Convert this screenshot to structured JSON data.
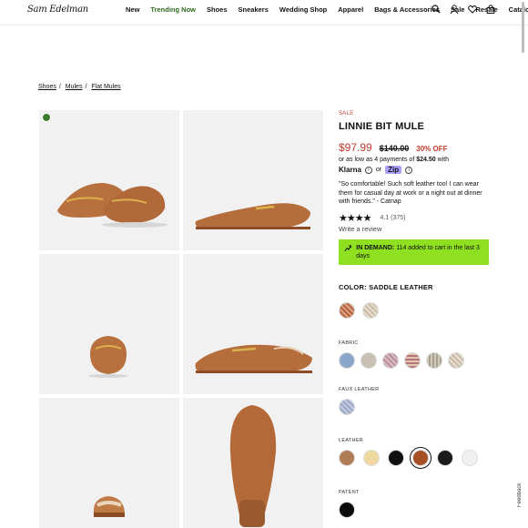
{
  "header": {
    "logo_text": "Sam Edelman",
    "nav": [
      "New",
      "Trending Now",
      "Shoes",
      "Sneakers",
      "Wedding Shop",
      "Apparel",
      "Bags & Accessories",
      "Sale",
      "Resale",
      "Catalog"
    ],
    "icons": [
      "search-icon",
      "account-icon",
      "wishlist-icon",
      "bag-icon"
    ]
  },
  "breadcrumb": [
    "Shoes",
    "Mules",
    "Flat Mules"
  ],
  "gallery": {
    "images": [
      "mule-angle-view",
      "mule-side-view",
      "mule-front-view",
      "mule-side-profile",
      "mule-back-view",
      "mule-sole-view"
    ]
  },
  "product": {
    "sale_label": "SALE",
    "title": "LINNIE BIT MULE",
    "price_now": "$97.99",
    "price_was": "$140.00",
    "discount": "30% OFF",
    "installments_prefix": "or as low as 4 payments of",
    "installments_amount": "$24.50",
    "installments_suffix": "with",
    "klarna": "Klarna",
    "pay_or": "or",
    "zip": "Zip",
    "quote": "\"So comfortable! Such soft leather too! I can wear them for casual day at work or a night out at dinner with friends.\" - Catnap",
    "stars": "★★★★",
    "rating": "4.1 (375)",
    "write_review": "Write a review",
    "demand_label": "IN DEMAND:",
    "demand_text": "114 added to cart in the last 3 days",
    "color_label": "COLOR:",
    "color_value": "SADDLE LEATHER",
    "sections": [
      "FABRIC",
      "FAUX LEATHER",
      "LEATHER",
      "PATENT"
    ]
  },
  "swatch_colors": {
    "top": [
      "#b6623d",
      "#e6dccf"
    ],
    "fabric": [
      "#8aa6c9",
      "#c9bfb2",
      "#d9c0c8",
      "#b7737a",
      "#d2c9b8",
      "#c8b8a4"
    ],
    "faux": [
      "#9aa7c6"
    ],
    "leather": [
      "#b07c55",
      "#efd9a0",
      "#111111",
      "#a64f25",
      "#1b1b1b",
      "#f0f0f0"
    ],
    "patent": [
      "#0b0b0b"
    ]
  },
  "feedback": "Feedback"
}
